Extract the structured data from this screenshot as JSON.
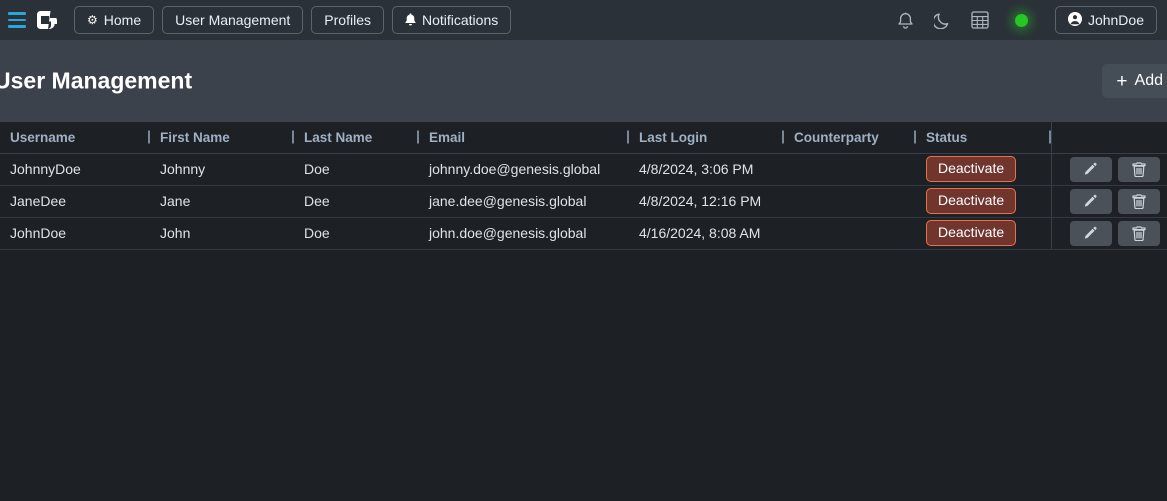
{
  "topnav": {
    "menu_icon": "hamburger-menu-icon",
    "logo_icon": "genesis-logo-icon",
    "items": [
      {
        "label": "Home",
        "icon": "gear-icon",
        "glyph": "⚙"
      },
      {
        "label": "User Management",
        "icon": "",
        "glyph": ""
      },
      {
        "label": "Profiles",
        "icon": "",
        "glyph": ""
      },
      {
        "label": "Notifications",
        "icon": "bell-icon",
        "glyph": "🔔"
      }
    ],
    "right_icons": [
      {
        "name": "notifications-bell-icon"
      },
      {
        "name": "dark-mode-moon-icon"
      },
      {
        "name": "apps-grid-icon"
      }
    ],
    "status_indicator": {
      "name": "connection-status-dot",
      "color": "#24c724"
    },
    "user": {
      "label": "JohnDoe",
      "icon": "user-avatar-icon"
    }
  },
  "page": {
    "title": "User Management",
    "add_button": {
      "label": "Add",
      "icon": "plus-icon"
    }
  },
  "table": {
    "columns": [
      "Username",
      "First Name",
      "Last Name",
      "Email",
      "Last Login",
      "Counterparty",
      "Status"
    ],
    "rows": [
      {
        "username": "JohnnyDoe",
        "first_name": "Johnny",
        "last_name": "Doe",
        "email": "johnny.doe@genesis.global",
        "last_login": "4/8/2024, 3:06 PM",
        "counterparty": "",
        "status_action": "Deactivate"
      },
      {
        "username": "JaneDee",
        "first_name": "Jane",
        "last_name": "Dee",
        "email": "jane.dee@genesis.global",
        "last_login": "4/8/2024, 12:16 PM",
        "counterparty": "",
        "status_action": "Deactivate"
      },
      {
        "username": "JohnDoe",
        "first_name": "John",
        "last_name": "Doe",
        "email": "john.doe@genesis.global",
        "last_login": "4/16/2024, 8:08 AM",
        "counterparty": "",
        "status_action": "Deactivate"
      }
    ],
    "row_actions": [
      {
        "name": "edit-row-button",
        "icon": "pencil-icon"
      },
      {
        "name": "delete-row-button",
        "icon": "trash-icon"
      }
    ]
  },
  "colors": {
    "topnav_bg": "#2b3138",
    "title_bg": "#3b424b",
    "table_bg": "#1d2025",
    "accent_cyan": "#29a8d8",
    "status_green": "#24c724",
    "deactivate_bg": "#70362e",
    "deactivate_border": "#e8734a",
    "header_text": "#9fb0c4"
  }
}
